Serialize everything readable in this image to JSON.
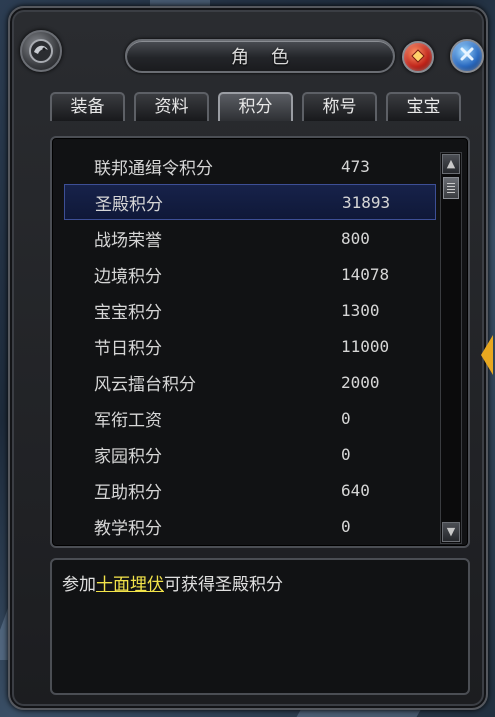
{
  "window": {
    "title": "角色",
    "title_chars": [
      "角",
      "色"
    ]
  },
  "tabs": [
    {
      "label": "装备",
      "active": false
    },
    {
      "label": "资料",
      "active": false
    },
    {
      "label": "积分",
      "active": true
    },
    {
      "label": "称号",
      "active": false
    },
    {
      "label": "宝宝",
      "active": false
    }
  ],
  "scores": [
    {
      "name": "联邦通缉令积分",
      "value": "473",
      "selected": false
    },
    {
      "name": "圣殿积分",
      "value": "31893",
      "selected": true
    },
    {
      "name": "战场荣誉",
      "value": "800",
      "selected": false
    },
    {
      "name": "边境积分",
      "value": "14078",
      "selected": false
    },
    {
      "name": "宝宝积分",
      "value": "1300",
      "selected": false
    },
    {
      "name": "节日积分",
      "value": "11000",
      "selected": false
    },
    {
      "name": "风云擂台积分",
      "value": "2000",
      "selected": false
    },
    {
      "name": "军衔工资",
      "value": "0",
      "selected": false
    },
    {
      "name": "家园积分",
      "value": "0",
      "selected": false
    },
    {
      "name": "互助积分",
      "value": "640",
      "selected": false
    },
    {
      "name": "教学积分",
      "value": "0",
      "selected": false
    }
  ],
  "description": {
    "prefix": "参加",
    "link": "十面埋伏",
    "suffix": "可获得圣殿积分"
  },
  "icons": {
    "emblem": "dragon-emblem-icon",
    "red_button": "red-gem-icon",
    "close_button": "close-x-icon",
    "scroll_up": "triangle-up-icon",
    "scroll_down": "triangle-down-icon",
    "side_handle": "triangle-left-icon"
  },
  "colors": {
    "selected_row": "#17224a",
    "link": "#f2e34a",
    "handle": "#e8a820"
  }
}
